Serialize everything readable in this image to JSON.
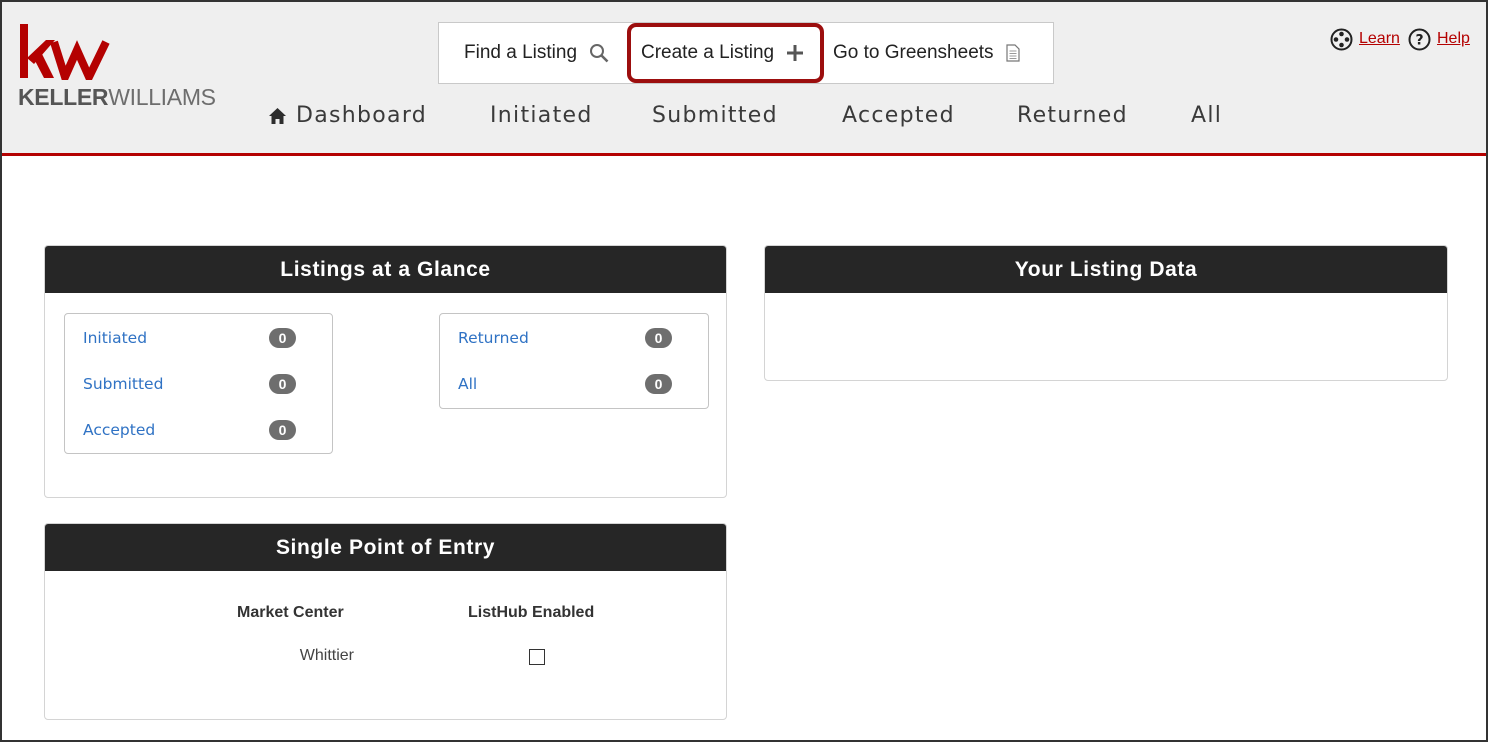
{
  "logo": {
    "word_bold": "KELLER",
    "word_light": "WILLIAMS"
  },
  "actions": {
    "find": "Find a Listing",
    "create": "Create a Listing",
    "greensheets": "Go to Greensheets"
  },
  "nav": {
    "dashboard": "Dashboard",
    "initiated": "Initiated",
    "submitted": "Submitted",
    "accepted": "Accepted",
    "returned": "Returned",
    "all": "All"
  },
  "util": {
    "learn": "Learn",
    "help": "Help"
  },
  "glance": {
    "title": "Listings at a Glance",
    "left_items": [
      {
        "label": "Initiated",
        "count": "0"
      },
      {
        "label": "Submitted",
        "count": "0"
      },
      {
        "label": "Accepted",
        "count": "0"
      }
    ],
    "right_items": [
      {
        "label": "Returned",
        "count": "0"
      },
      {
        "label": "All",
        "count": "0"
      }
    ]
  },
  "listing_data": {
    "title": "Your Listing Data"
  },
  "spoe": {
    "title": "Single Point of Entry",
    "col_market_center": "Market Center",
    "col_listhub": "ListHub Enabled",
    "rows": [
      {
        "market_center": "Whittier",
        "listhub_enabled": false
      }
    ]
  },
  "colors": {
    "brand_red": "#b40101",
    "link_blue": "#2f72c4",
    "panel_header": "#262626",
    "badge_gray": "#6e6e6e",
    "highlight": "#9c0e0e"
  }
}
